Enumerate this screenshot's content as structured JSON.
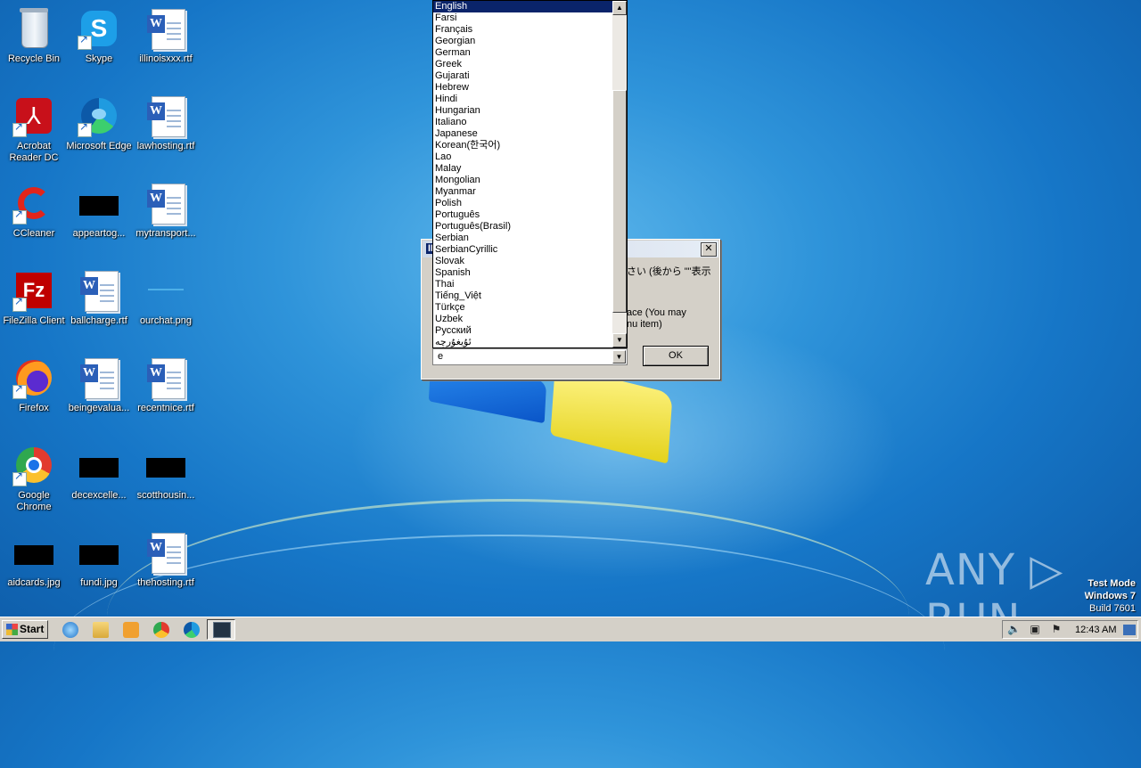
{
  "desktop": {
    "icons": [
      {
        "label": "Recycle Bin"
      },
      {
        "label": "Skype"
      },
      {
        "label": "illinoisxxx.rtf"
      },
      {
        "label": "Acrobat Reader DC"
      },
      {
        "label": "Microsoft Edge"
      },
      {
        "label": "lawhosting.rtf"
      },
      {
        "label": "CCleaner"
      },
      {
        "label": "appeartog..."
      },
      {
        "label": "mytransport..."
      },
      {
        "label": "FileZilla Client"
      },
      {
        "label": "ballcharge.rtf"
      },
      {
        "label": "ourchat.png"
      },
      {
        "label": "Firefox"
      },
      {
        "label": "beingevalua..."
      },
      {
        "label": "recentnice.rtf"
      },
      {
        "label": "Google Chrome"
      },
      {
        "label": "decexcelle..."
      },
      {
        "label": "scotthousin..."
      },
      {
        "label": "aidcards.jpg"
      },
      {
        "label": "fundi.jpg"
      },
      {
        "label": "thehosting.rtf"
      }
    ]
  },
  "dialog": {
    "title_fragment": "IE",
    "text_line1": "さい (後から \"\"表示",
    "text_line2": "ace (You may",
    "text_line3": "nu item)",
    "ok_label": "OK",
    "close_glyph": "✕"
  },
  "language_list": {
    "items": [
      "English",
      "Farsi",
      "Français",
      "Georgian",
      "German",
      "Greek",
      "Gujarati",
      "Hebrew",
      "Hindi",
      "Hungarian",
      "Italiano",
      "Japanese",
      "Korean(한국어)",
      "Lao",
      "Malay",
      "Mongolian",
      "Myanmar",
      "Polish",
      "Português",
      "Português(Brasil)",
      "Serbian",
      "SerbianCyrillic",
      "Slovak",
      "Spanish",
      "Thai",
      "Tiếng_Việt",
      "Türkçe",
      "Uzbek",
      "Русский",
      "ئۇيغۇرچە"
    ],
    "selected": "English",
    "combo_value": "e"
  },
  "watermark": {
    "brand": "ANY ▷ RUN",
    "line1": "Test Mode",
    "line2": "Windows 7",
    "line3": "Build 7601"
  },
  "taskbar": {
    "start_label": "Start",
    "clock": "12:43 AM",
    "pinned": [
      "internet-explorer-icon",
      "explorer-icon",
      "media-player-icon",
      "chrome-icon",
      "edge-icon",
      "app-window-icon"
    ]
  }
}
